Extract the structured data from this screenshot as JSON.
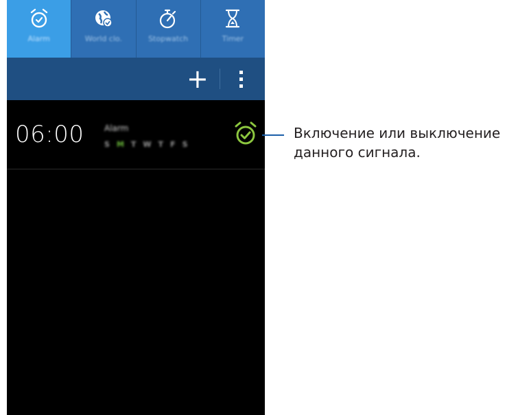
{
  "tabs": [
    {
      "label": "Alarm",
      "icon": "alarm-clock-icon",
      "active": true
    },
    {
      "label": "World clo.",
      "icon": "globe-icon",
      "active": false
    },
    {
      "label": "Stopwatch",
      "icon": "stopwatch-icon",
      "active": false
    },
    {
      "label": "Timer",
      "icon": "hourglass-icon",
      "active": false
    }
  ],
  "actionbar": {
    "add_label": "+",
    "menu_icon": "more-vert-icon"
  },
  "alarm": {
    "time": "06:00",
    "name": "Alarm",
    "days": [
      {
        "letter": "S",
        "on": false
      },
      {
        "letter": "M",
        "on": true
      },
      {
        "letter": "T",
        "on": false
      },
      {
        "letter": "W",
        "on": false
      },
      {
        "letter": "T",
        "on": false
      },
      {
        "letter": "F",
        "on": false
      },
      {
        "letter": "S",
        "on": false
      }
    ],
    "toggle_icon": "alarm-on-icon",
    "toggle_color": "#8cc63f"
  },
  "callout": {
    "line1": "Включение или выключение",
    "line2": "данного сигнала."
  },
  "colors": {
    "tab_bar": "#2f6fb4",
    "tab_active": "#3b9ee6",
    "action_bar": "#1f4f82",
    "background": "#000000",
    "callout_line": "#1a5ea8"
  }
}
